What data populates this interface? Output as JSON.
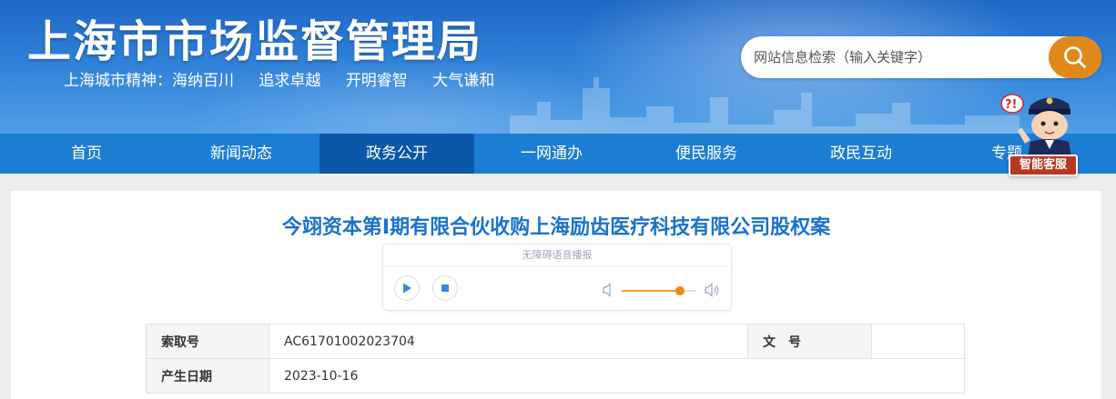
{
  "header": {
    "site_title": "上海市市场监督管理局",
    "slogan_prefix": "上海城市精神：",
    "slogan_items": [
      "海纳百川",
      "追求卓越",
      "开明睿智",
      "大气谦和"
    ]
  },
  "search": {
    "placeholder": "网站信息检索（输入关键字）",
    "icon": "search-icon"
  },
  "nav": {
    "items": [
      {
        "label": "首页"
      },
      {
        "label": "新闻动态"
      },
      {
        "label": "政务公开",
        "active": true
      },
      {
        "label": "一网通办"
      },
      {
        "label": "便民服务"
      },
      {
        "label": "政民互动"
      },
      {
        "label": "专题"
      }
    ]
  },
  "assistant": {
    "label": "智能客服"
  },
  "article": {
    "title": "今翊资本第Ⅰ期有限合伙收购上海励齿医疗科技有限公司股权案"
  },
  "player": {
    "caption": "无障碍语音播报",
    "volume": 0.78
  },
  "meta": {
    "rows": [
      {
        "k1": "索取号",
        "v1": "AC61701002023704",
        "k2": "文　号",
        "v2": ""
      },
      {
        "k1": "产生日期",
        "v1": "2023-10-16"
      }
    ]
  },
  "colors": {
    "accent": "#1a73c9",
    "nav_bg": "#1b7ed2",
    "nav_active": "#0b57a8",
    "search_btn": "#e0891b"
  }
}
